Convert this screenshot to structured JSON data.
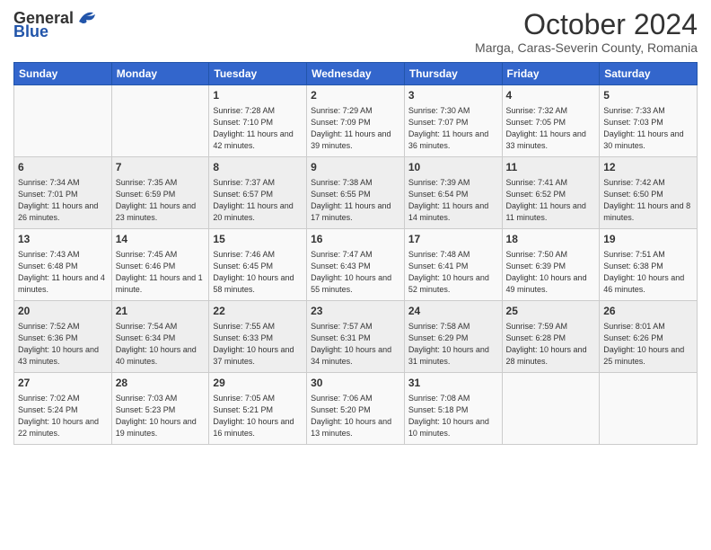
{
  "header": {
    "logo_general": "General",
    "logo_blue": "Blue",
    "title": "October 2024",
    "subtitle": "Marga, Caras-Severin County, Romania"
  },
  "days_of_week": [
    "Sunday",
    "Monday",
    "Tuesday",
    "Wednesday",
    "Thursday",
    "Friday",
    "Saturday"
  ],
  "weeks": [
    [
      {
        "day": "",
        "content": ""
      },
      {
        "day": "",
        "content": ""
      },
      {
        "day": "1",
        "content": "Sunrise: 7:28 AM\nSunset: 7:10 PM\nDaylight: 11 hours and 42 minutes."
      },
      {
        "day": "2",
        "content": "Sunrise: 7:29 AM\nSunset: 7:09 PM\nDaylight: 11 hours and 39 minutes."
      },
      {
        "day": "3",
        "content": "Sunrise: 7:30 AM\nSunset: 7:07 PM\nDaylight: 11 hours and 36 minutes."
      },
      {
        "day": "4",
        "content": "Sunrise: 7:32 AM\nSunset: 7:05 PM\nDaylight: 11 hours and 33 minutes."
      },
      {
        "day": "5",
        "content": "Sunrise: 7:33 AM\nSunset: 7:03 PM\nDaylight: 11 hours and 30 minutes."
      }
    ],
    [
      {
        "day": "6",
        "content": "Sunrise: 7:34 AM\nSunset: 7:01 PM\nDaylight: 11 hours and 26 minutes."
      },
      {
        "day": "7",
        "content": "Sunrise: 7:35 AM\nSunset: 6:59 PM\nDaylight: 11 hours and 23 minutes."
      },
      {
        "day": "8",
        "content": "Sunrise: 7:37 AM\nSunset: 6:57 PM\nDaylight: 11 hours and 20 minutes."
      },
      {
        "day": "9",
        "content": "Sunrise: 7:38 AM\nSunset: 6:55 PM\nDaylight: 11 hours and 17 minutes."
      },
      {
        "day": "10",
        "content": "Sunrise: 7:39 AM\nSunset: 6:54 PM\nDaylight: 11 hours and 14 minutes."
      },
      {
        "day": "11",
        "content": "Sunrise: 7:41 AM\nSunset: 6:52 PM\nDaylight: 11 hours and 11 minutes."
      },
      {
        "day": "12",
        "content": "Sunrise: 7:42 AM\nSunset: 6:50 PM\nDaylight: 11 hours and 8 minutes."
      }
    ],
    [
      {
        "day": "13",
        "content": "Sunrise: 7:43 AM\nSunset: 6:48 PM\nDaylight: 11 hours and 4 minutes."
      },
      {
        "day": "14",
        "content": "Sunrise: 7:45 AM\nSunset: 6:46 PM\nDaylight: 11 hours and 1 minute."
      },
      {
        "day": "15",
        "content": "Sunrise: 7:46 AM\nSunset: 6:45 PM\nDaylight: 10 hours and 58 minutes."
      },
      {
        "day": "16",
        "content": "Sunrise: 7:47 AM\nSunset: 6:43 PM\nDaylight: 10 hours and 55 minutes."
      },
      {
        "day": "17",
        "content": "Sunrise: 7:48 AM\nSunset: 6:41 PM\nDaylight: 10 hours and 52 minutes."
      },
      {
        "day": "18",
        "content": "Sunrise: 7:50 AM\nSunset: 6:39 PM\nDaylight: 10 hours and 49 minutes."
      },
      {
        "day": "19",
        "content": "Sunrise: 7:51 AM\nSunset: 6:38 PM\nDaylight: 10 hours and 46 minutes."
      }
    ],
    [
      {
        "day": "20",
        "content": "Sunrise: 7:52 AM\nSunset: 6:36 PM\nDaylight: 10 hours and 43 minutes."
      },
      {
        "day": "21",
        "content": "Sunrise: 7:54 AM\nSunset: 6:34 PM\nDaylight: 10 hours and 40 minutes."
      },
      {
        "day": "22",
        "content": "Sunrise: 7:55 AM\nSunset: 6:33 PM\nDaylight: 10 hours and 37 minutes."
      },
      {
        "day": "23",
        "content": "Sunrise: 7:57 AM\nSunset: 6:31 PM\nDaylight: 10 hours and 34 minutes."
      },
      {
        "day": "24",
        "content": "Sunrise: 7:58 AM\nSunset: 6:29 PM\nDaylight: 10 hours and 31 minutes."
      },
      {
        "day": "25",
        "content": "Sunrise: 7:59 AM\nSunset: 6:28 PM\nDaylight: 10 hours and 28 minutes."
      },
      {
        "day": "26",
        "content": "Sunrise: 8:01 AM\nSunset: 6:26 PM\nDaylight: 10 hours and 25 minutes."
      }
    ],
    [
      {
        "day": "27",
        "content": "Sunrise: 7:02 AM\nSunset: 5:24 PM\nDaylight: 10 hours and 22 minutes."
      },
      {
        "day": "28",
        "content": "Sunrise: 7:03 AM\nSunset: 5:23 PM\nDaylight: 10 hours and 19 minutes."
      },
      {
        "day": "29",
        "content": "Sunrise: 7:05 AM\nSunset: 5:21 PM\nDaylight: 10 hours and 16 minutes."
      },
      {
        "day": "30",
        "content": "Sunrise: 7:06 AM\nSunset: 5:20 PM\nDaylight: 10 hours and 13 minutes."
      },
      {
        "day": "31",
        "content": "Sunrise: 7:08 AM\nSunset: 5:18 PM\nDaylight: 10 hours and 10 minutes."
      },
      {
        "day": "",
        "content": ""
      },
      {
        "day": "",
        "content": ""
      }
    ]
  ]
}
